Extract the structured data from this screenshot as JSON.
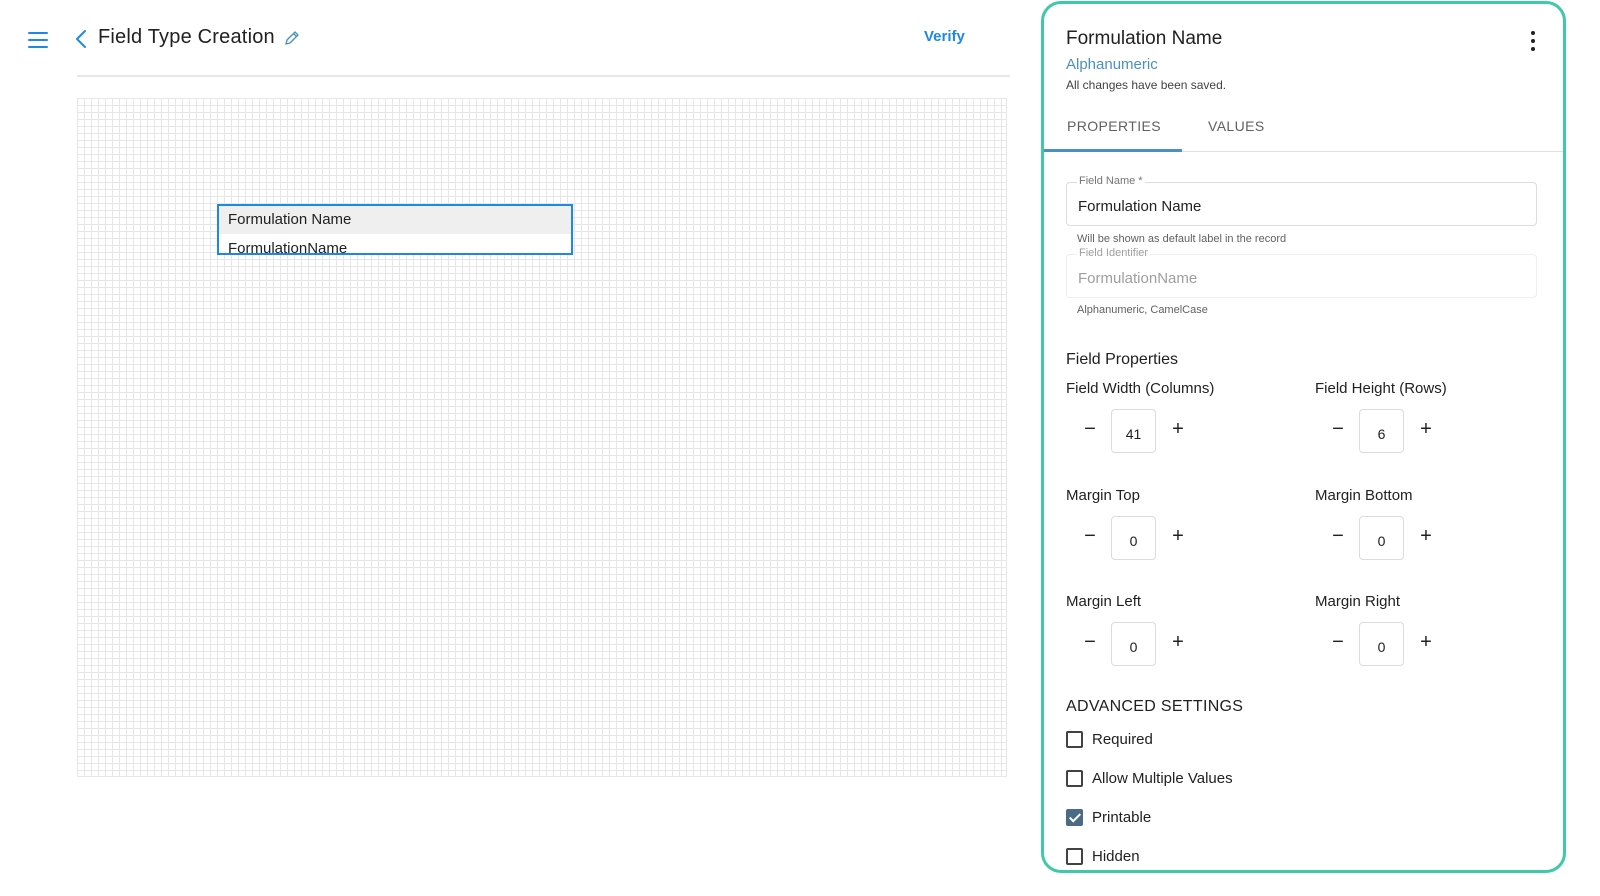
{
  "header": {
    "title": "Field Type Creation",
    "verify_label": "Verify"
  },
  "canvas": {
    "field_label": "Formulation Name",
    "field_identifier": "FormulationName"
  },
  "panel": {
    "title": "Formulation Name",
    "type": "Alphanumeric",
    "status": "All changes have been saved.",
    "tabs": [
      {
        "label": "PROPERTIES",
        "active": true
      },
      {
        "label": "VALUES",
        "active": false
      }
    ],
    "field_name": {
      "label": "Field Name *",
      "value": "Formulation Name",
      "helper": "Will be shown as default label in the record"
    },
    "field_identifier": {
      "label": "Field Identifier",
      "value": "FormulationName",
      "helper": "Alphanumeric, CamelCase"
    },
    "field_properties_title": "Field Properties",
    "properties": {
      "field_width": {
        "label": "Field Width (Columns)",
        "value": "41"
      },
      "field_height": {
        "label": "Field Height (Rows)",
        "value": "6"
      },
      "margin_top": {
        "label": "Margin Top",
        "value": "0"
      },
      "margin_bottom": {
        "label": "Margin Bottom",
        "value": "0"
      },
      "margin_left": {
        "label": "Margin Left",
        "value": "0"
      },
      "margin_right": {
        "label": "Margin Right",
        "value": "0"
      }
    },
    "stepper_minus": "−",
    "stepper_plus": "+",
    "advanced_title": "ADVANCED SETTINGS",
    "advanced": [
      {
        "label": "Required",
        "checked": false
      },
      {
        "label": "Allow Multiple Values",
        "checked": false
      },
      {
        "label": "Printable",
        "checked": true
      },
      {
        "label": "Hidden",
        "checked": false
      }
    ]
  },
  "colors": {
    "accent": "#1e88e5",
    "panel_border": "#3ec9a7",
    "type_text": "#4a90c4",
    "checkbox_checked": "#4a6b85"
  },
  "icons": {
    "menu": "hamburger-menu-icon",
    "back": "chevron-left-icon",
    "edit": "pencil-icon",
    "more": "more-vertical-icon"
  }
}
